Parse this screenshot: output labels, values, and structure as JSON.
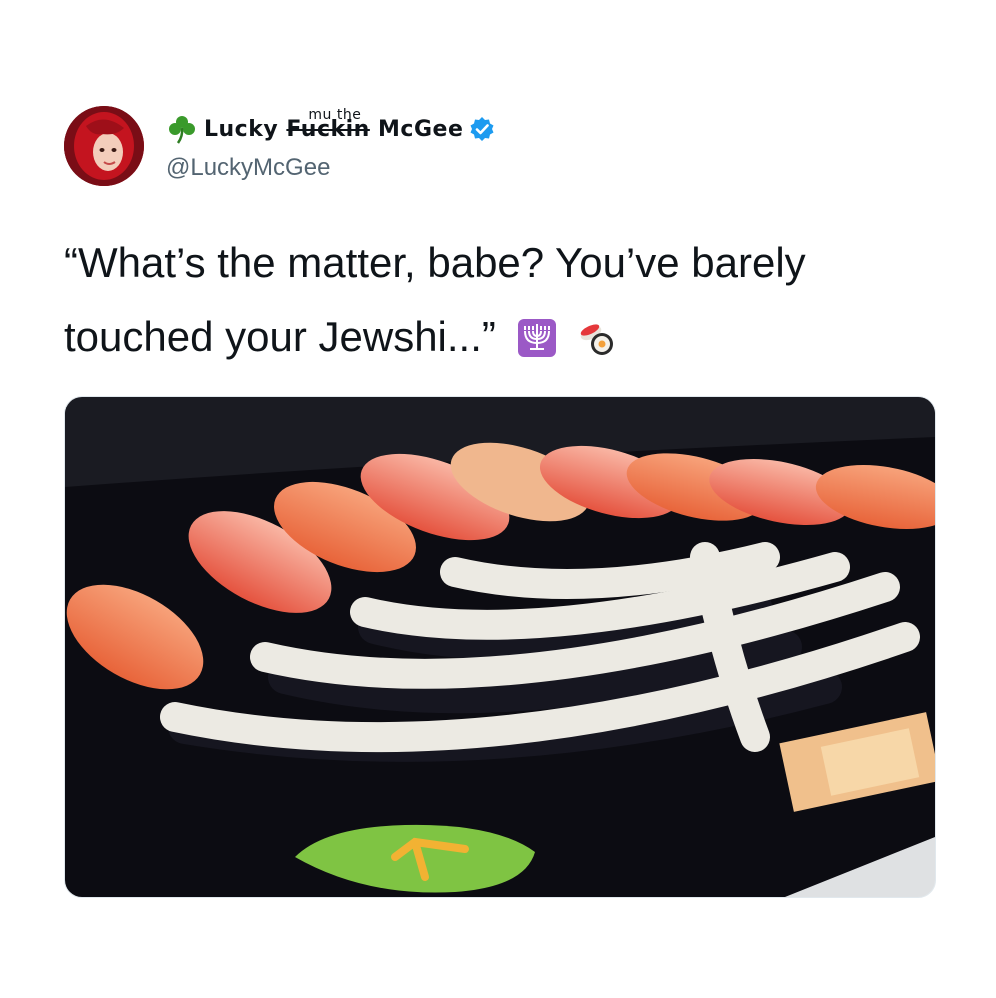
{
  "tweet": {
    "author": {
      "display_name": "Lucky F̶u̶c̶k̶i̶n̶ McGee",
      "name_prefix": "Lucky",
      "name_middle": "Fuckin",
      "name_middle_overlay": "mu the",
      "name_suffix": "McGee",
      "handle": "@LuckyMcGee",
      "verified": true,
      "icon_shamrock": "shamrock-icon",
      "icon_verified": "verified-badge-icon"
    },
    "text": "“What’s the matter, babe? You’ve barely touched your Jewshi...”",
    "emojis": [
      "menorah-emoji",
      "sushi-emoji"
    ],
    "media": {
      "description_icon": "menorah-sushi-photo"
    }
  },
  "colors": {
    "text": "#0f1419",
    "secondary": "#536471",
    "verified": "#1d9bf0",
    "shamrock": "#3a9a2b"
  }
}
